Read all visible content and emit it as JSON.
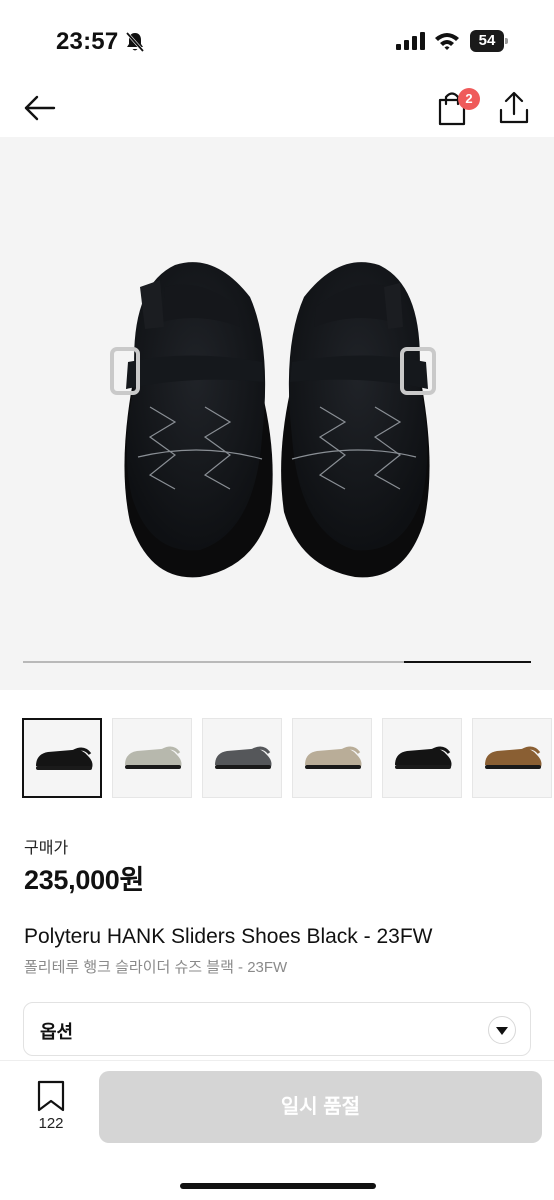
{
  "status_bar": {
    "time": "23:57",
    "battery": "54",
    "battery_level_pct": 54,
    "icons": [
      "bell-slash-icon",
      "signal-icon",
      "wifi-icon",
      "battery-icon"
    ]
  },
  "header": {
    "icons": [
      "arrow-left-icon",
      "shopping-bag-icon",
      "share-icon"
    ],
    "cart_badge": "2"
  },
  "gallery": {
    "image": "black-suede-clog-sandals",
    "thumbnails": [
      {
        "color": "black",
        "selected": true
      },
      {
        "color": "light-grey",
        "selected": false
      },
      {
        "color": "dark-grey",
        "selected": false
      },
      {
        "color": "beige",
        "selected": false
      },
      {
        "color": "black",
        "selected": false
      },
      {
        "color": "brown",
        "selected": false
      }
    ],
    "progress_start_pct": 75,
    "progress_end_pct": 100
  },
  "product": {
    "price_label": "구매가",
    "price": "235,000원",
    "title_en": "Polyteru HANK Sliders Shoes Black - 23FW",
    "title_ko": "폴리테루 행크 슬라이더 슈즈 블랙 - 23FW"
  },
  "option": {
    "label": "옵션",
    "icon": "caret-down-icon"
  },
  "bottom_bar": {
    "wish_count": "122",
    "buy_label": "일시 품절",
    "icon": "bookmark-icon"
  },
  "colors": {
    "badge": "#ef5a5a",
    "buy_button_disabled": "#d5d5d5",
    "hero_background": "#f4f4f4"
  }
}
